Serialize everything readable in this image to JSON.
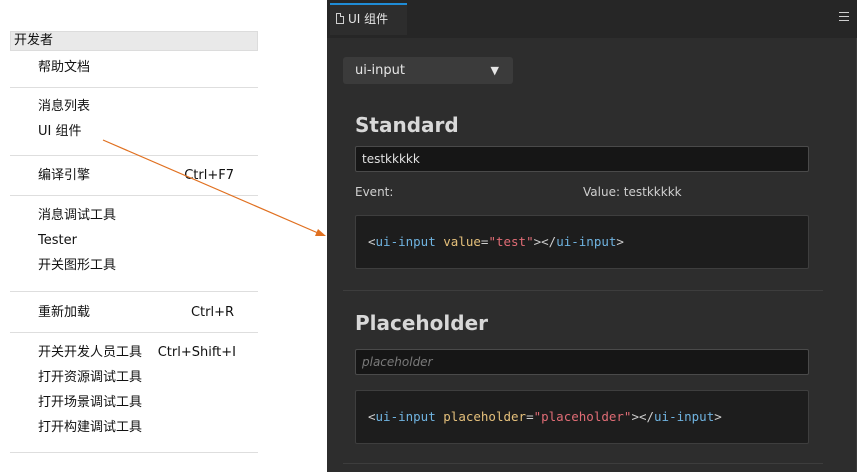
{
  "menu": {
    "header": "开发者",
    "items": [
      {
        "label": "帮助文档",
        "shortcut": ""
      },
      {
        "label": "消息列表",
        "shortcut": ""
      },
      {
        "label": "UI 组件",
        "shortcut": ""
      },
      {
        "label": "编译引擎",
        "shortcut": "Ctrl+F7"
      },
      {
        "label": "消息调试工具",
        "shortcut": ""
      },
      {
        "label": "Tester",
        "shortcut": ""
      },
      {
        "label": "开关图形工具",
        "shortcut": ""
      },
      {
        "label": "重新加载",
        "shortcut": "Ctrl+R"
      },
      {
        "label": "开关开发人员工具",
        "shortcut": "Ctrl+Shift+I"
      },
      {
        "label": "打开资源调试工具",
        "shortcut": ""
      },
      {
        "label": "打开场景调试工具",
        "shortcut": ""
      },
      {
        "label": "打开构建调试工具",
        "shortcut": ""
      }
    ]
  },
  "panel": {
    "tab_title": "UI 组件",
    "menu_icon": "hamburger-menu-icon",
    "select": {
      "value": "ui-input",
      "caret": "▼"
    },
    "standard": {
      "title": "Standard",
      "input_value": "testkkkkk",
      "event_label": "Event:",
      "value_label": "Value: testkkkkk",
      "code": {
        "open_lt": "<",
        "tag": "ui-input",
        "attr": "value",
        "eq": "=",
        "str": "\"test\"",
        "close_mid": "></",
        "end_tag": "ui-input",
        "gt": ">"
      }
    },
    "placeholder_section": {
      "title": "Placeholder",
      "placeholder": "placeholder",
      "code": {
        "open_lt": "<",
        "tag": "ui-input",
        "attr": "placeholder",
        "eq": "=",
        "str": "\"placeholder\"",
        "close_mid": "></",
        "end_tag": "ui-input",
        "gt": ">"
      }
    }
  },
  "colors": {
    "arrow": "#e07020",
    "tab_accent": "#1f8cd6",
    "panel_bg": "#2d2d2d"
  }
}
